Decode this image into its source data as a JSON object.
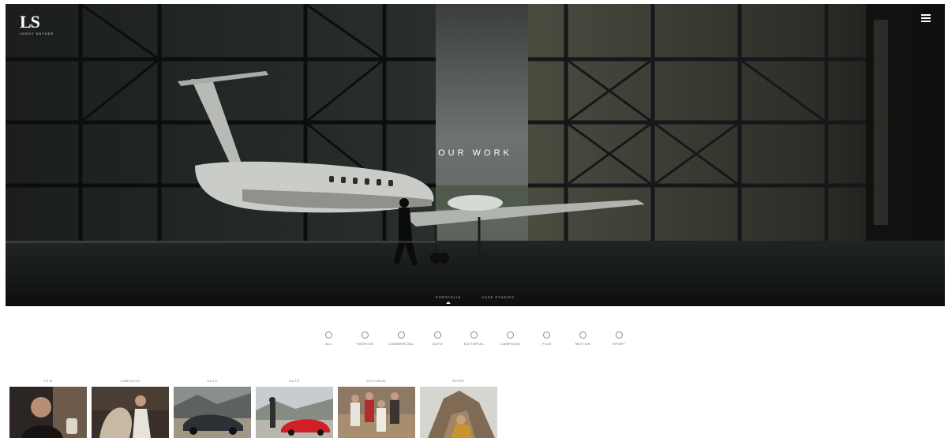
{
  "brand": {
    "logo": "LS",
    "tagline": "LEROY SNYDER"
  },
  "hero": {
    "title": "OUR WORK",
    "tabs": [
      {
        "label": "PORTFOLIO",
        "active": true
      },
      {
        "label": "CASE STUDIES",
        "active": false
      }
    ]
  },
  "filters": [
    {
      "label": "ALL"
    },
    {
      "label": "FASHION"
    },
    {
      "label": "COMMERCIAL"
    },
    {
      "label": "AUTO"
    },
    {
      "label": "EDITORIAL"
    },
    {
      "label": "CAMPAIGN"
    },
    {
      "label": "FILM"
    },
    {
      "label": "MOTION"
    },
    {
      "label": "SPORT"
    }
  ],
  "thumbnails": [
    {
      "caption": "FILM",
      "icon": "portrait-photo"
    },
    {
      "caption": "CAMPAIGN",
      "icon": "fashion-photo"
    },
    {
      "caption": "AUTO",
      "icon": "car-photo"
    },
    {
      "caption": "AUTO",
      "icon": "sportscar-photo"
    },
    {
      "caption": "EDITORIAL",
      "icon": "group-photo"
    },
    {
      "caption": "SPORT",
      "icon": "outdoor-photo"
    }
  ],
  "colors": {
    "hero_dark": "#15181a",
    "accent": "#ffffff",
    "label_gray": "#666666"
  }
}
